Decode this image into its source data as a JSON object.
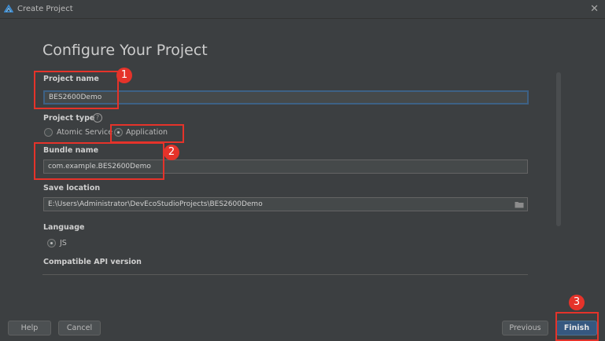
{
  "window": {
    "title": "Create Project",
    "close_icon": "✕"
  },
  "heading": "Configure Your Project",
  "project_name": {
    "label": "Project name",
    "value": "BES2600Demo"
  },
  "project_type": {
    "label": "Project type",
    "help_icon": "?",
    "options": [
      {
        "label": "Atomic Service",
        "selected": false
      },
      {
        "label": "Application",
        "selected": true
      }
    ]
  },
  "bundle_name": {
    "label": "Bundle name",
    "value": "com.example.BES2600Demo"
  },
  "save_location": {
    "label": "Save location",
    "value": "E:\\Users\\Administrator\\DevEcoStudioProjects\\BES2600Demo"
  },
  "language": {
    "label": "Language",
    "options": [
      {
        "label": "JS",
        "selected": true
      }
    ]
  },
  "compatible_api": {
    "label": "Compatible API version"
  },
  "footer": {
    "help": "Help",
    "cancel": "Cancel",
    "previous": "Previous",
    "finish": "Finish"
  },
  "annotations": {
    "step1": "1",
    "step2": "2",
    "step3": "3",
    "color": "#e5332a"
  },
  "colors": {
    "background": "#3c3f41",
    "accent": "#365880",
    "focus_border": "#3d6185"
  }
}
